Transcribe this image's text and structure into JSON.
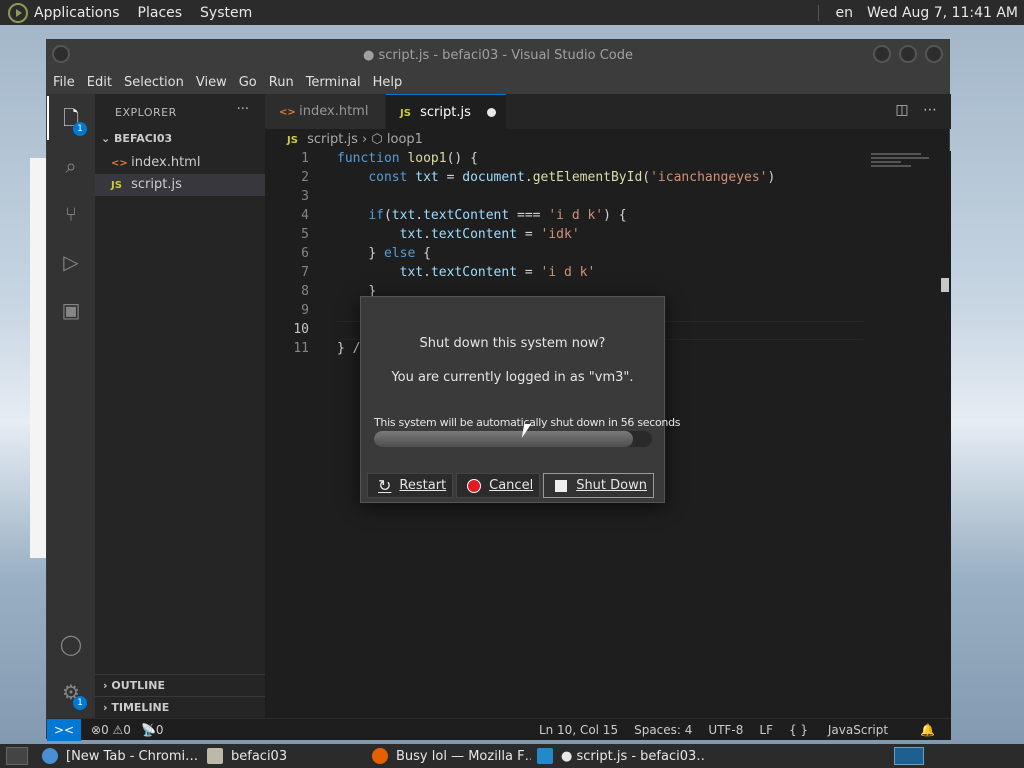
{
  "top_panel": {
    "menus": [
      "Applications",
      "Places",
      "System"
    ],
    "lang": "en",
    "clock": "Wed Aug  7, 11:41 AM"
  },
  "window": {
    "title": "● script.js - befaci03 - Visual Studio Code",
    "menus": [
      "File",
      "Edit",
      "Selection",
      "View",
      "Go",
      "Run",
      "Terminal",
      "Help"
    ]
  },
  "activity": {
    "explorer_badge": "1",
    "settings_badge": "1"
  },
  "sidebar": {
    "header": "EXPLORER",
    "more": "···",
    "folder": "BEFACI03",
    "files": [
      {
        "name": "index.html",
        "type": "<>"
      },
      {
        "name": "script.js",
        "type": "JS"
      }
    ],
    "outline": "OUTLINE",
    "timeline": "TIMELINE"
  },
  "tabs": [
    {
      "label": "index.html",
      "icon": "<>"
    },
    {
      "label": "script.js",
      "icon": "JS"
    }
  ],
  "breadcrumb": {
    "file": "script.js",
    "file_icon": "JS",
    "symbol": "loop1"
  },
  "code": {
    "line_numbers": [
      "1",
      "2",
      "3",
      "4",
      "5",
      "6",
      "7",
      "8",
      "9",
      "10",
      "11"
    ],
    "l1_kw": "function",
    "l1_fn": "loop1",
    "l1_rest": "() {",
    "l2_kw": "const",
    "l2_var": "txt",
    "l2_eq": " = ",
    "l2_obj": "document",
    "l2_dot": ".",
    "l2_fn": "getElementById",
    "l2_open": "(",
    "l2_str": "'icanchangeyes'",
    "l2_close": ")",
    "l4_kw": "if",
    "l4_open": "(",
    "l4_var": "txt",
    "l4_dot": ".",
    "l4_prop": "textContent",
    "l4_op": " === ",
    "l4_str": "'i d k'",
    "l4_close": ") {",
    "l5_var": "txt",
    "l5_dot": ".",
    "l5_prop": "textContent",
    "l5_eq": " = ",
    "l5_str": "'idk'",
    "l6_close": "} ",
    "l6_kw": "else",
    "l6_brace": " {",
    "l7_var": "txt",
    "l7_dot": ".",
    "l7_prop": "textContent",
    "l7_eq": " = ",
    "l7_str": "'i d k'",
    "l8": "}",
    "l11": "} /"
  },
  "statusbar": {
    "remote": "><",
    "errors": "0",
    "warnings": "0",
    "ports": "0",
    "position": "Ln 10, Col 15",
    "spaces": "Spaces: 4",
    "encoding": "UTF-8",
    "eol": "LF",
    "language": "JavaScript"
  },
  "dialog": {
    "title": "Shut down this system now?",
    "message": "You are currently logged in as \"vm3\".",
    "countdown": "This system will be automatically shut down in 56 seconds",
    "progress": 0.93,
    "buttons": [
      "Restart",
      "Cancel",
      "Shut Down"
    ]
  },
  "taskbar": {
    "items": [
      {
        "label": "[New Tab - Chromi…",
        "color": "#4a8fd4"
      },
      {
        "label": "befaci03",
        "color": "#bdb8a8"
      },
      {
        "label": "Busy lol — Mozilla F…",
        "color": "#e66000"
      },
      {
        "label": "● script.js - befaci03…",
        "color": "#2489ca"
      }
    ]
  }
}
